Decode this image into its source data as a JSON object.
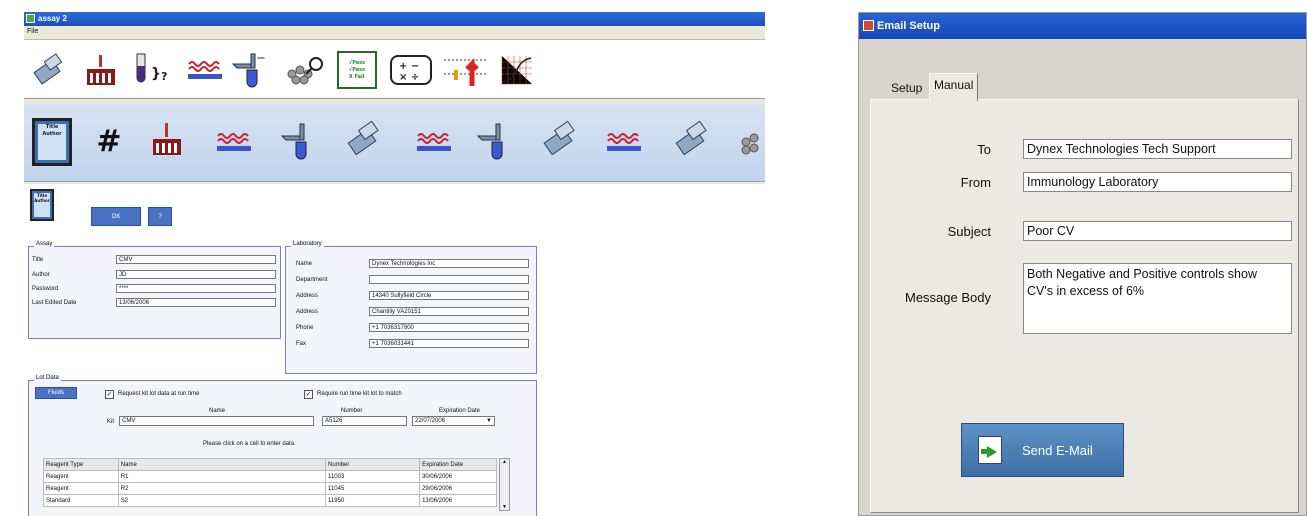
{
  "left_window": {
    "title": "assay 2",
    "menu": [
      "File"
    ],
    "toolbar_top": {
      "icons": [
        "plate-reader-icon",
        "reagent-rack-icon",
        "tube-query-icon",
        "plate-strip-icon",
        "wash-icon",
        "shake-icon",
        "pass-fail-icon",
        "calculator-icon",
        "threshold-icon",
        "curve-fit-icon"
      ],
      "pass_fail_text": "√Pass\n√Pass\nX Fail"
    },
    "toolbar_bottom": {
      "icons": [
        "title-card-icon",
        "grid-icon",
        "reagent-rack-icon",
        "plate-strip-icon",
        "wash-icon",
        "plate-reader-icon",
        "plate-strip-icon",
        "wash-icon",
        "plate-reader-icon",
        "plate-strip-icon",
        "plate-reader-icon",
        "shake-icon"
      ],
      "title_card_text": "Title\nAuthor"
    },
    "title_card_text": "Title\nAuthor",
    "buttons": {
      "ok": "OK",
      "help": "?"
    },
    "assay": {
      "group_title": "Assay",
      "fields": [
        {
          "label": "Title",
          "value": "CMV"
        },
        {
          "label": "Author",
          "value": "JD"
        },
        {
          "label": "Password",
          "value": "****"
        },
        {
          "label": "Last Edited Date",
          "value": "13/06/2006"
        }
      ]
    },
    "laboratory": {
      "group_title": "Laboratory",
      "fields": [
        {
          "label": "Name",
          "value": "Dynex Technologies Inc"
        },
        {
          "label": "Department",
          "value": ""
        },
        {
          "label": "Address",
          "value": "14340 Sullyfield Circle"
        },
        {
          "label": "Address",
          "value": "Chantilly VA20151"
        },
        {
          "label": "Phone",
          "value": "+1 7036317800"
        },
        {
          "label": "Fax",
          "value": "+1 7036031441"
        }
      ]
    },
    "lot_data": {
      "group_title": "Lot Data",
      "fluids_button": "Fluids",
      "check1": "Request kit lot data at run time",
      "check2": "Require run time kit lot to match",
      "hdr_name": "Name",
      "hdr_number": "Number",
      "hdr_exp": "Expiration Date",
      "kit_label": "Kit",
      "kit_name": "CMV",
      "kit_number": "A5126",
      "kit_exp": "22/07/2006",
      "instruction": "Please click on a cell to enter data.",
      "table_headers": [
        "Reagent Type",
        "Name",
        "Number",
        "Expiration Date"
      ],
      "rows": [
        [
          "Reagent",
          "R1",
          "11003",
          "30/06/2006"
        ],
        [
          "Reagent",
          "R2",
          "11045",
          "29/06/2006"
        ],
        [
          "Standard",
          "S2",
          "11950",
          "13/06/2006"
        ]
      ]
    }
  },
  "email_window": {
    "title": "Email Setup",
    "tabs": [
      "Setup",
      "Manual"
    ],
    "to_label": "To",
    "to_value": "Dynex Technologies Tech Support",
    "from_label": "From",
    "from_value": "Immunology Laboratory",
    "subject_label": "Subject",
    "subject_value": "Poor CV",
    "body_label": "Message Body",
    "body_line1": "Both Negative and Positive controls show",
    "body_line2": "CV's in excess of 6%",
    "send_label": "Send E-Mail"
  },
  "colors": {
    "titlebar": "#1b4fc0",
    "accent_blue": "#4a72c4",
    "toolbar_bottom_bg": "#c8d8ee"
  }
}
